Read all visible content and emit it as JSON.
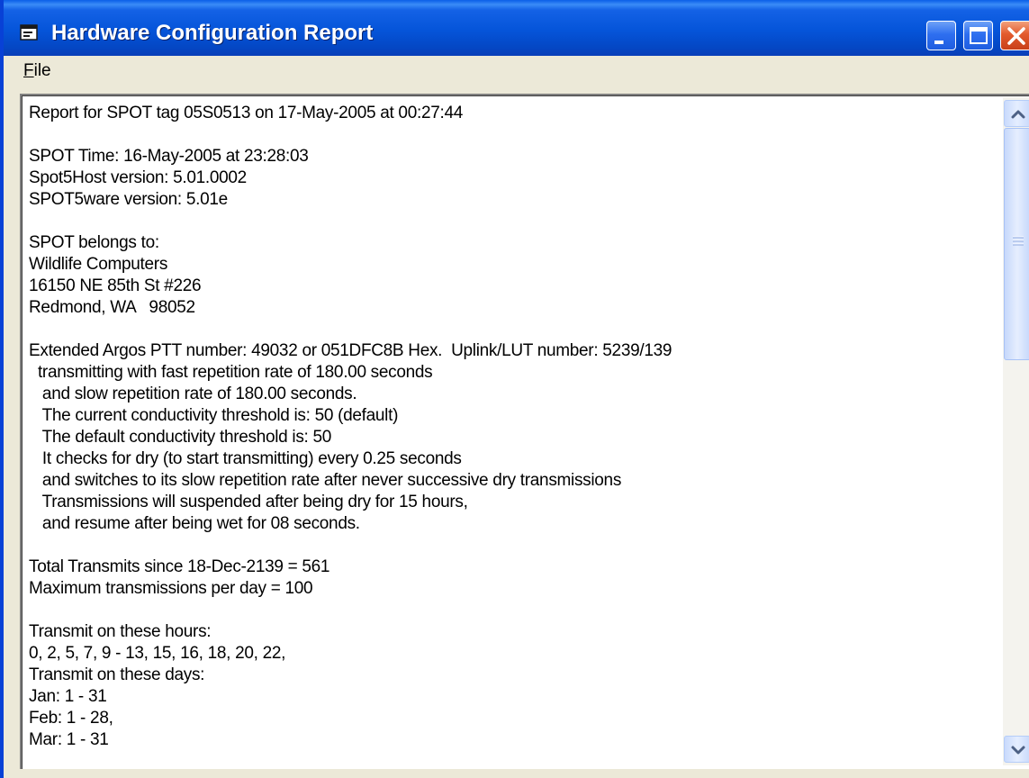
{
  "window": {
    "title": "Hardware Configuration Report",
    "icon": "app-window-icon",
    "controls": [
      "minimize-icon",
      "maximize-icon",
      "close-icon"
    ]
  },
  "menu": {
    "file_underlined": "F",
    "file_rest": "ile"
  },
  "report": {
    "lines": [
      "Report for SPOT tag 05S0513 on 17-May-2005 at 00:27:44",
      "",
      "SPOT Time: 16-May-2005 at 23:28:03",
      "Spot5Host version: 5.01.0002",
      "SPOT5ware version: 5.01e",
      "",
      "SPOT belongs to:",
      "Wildlife Computers",
      "16150 NE 85th St #226",
      "Redmond, WA   98052",
      "",
      "Extended Argos PTT number: 49032 or 051DFC8B Hex.  Uplink/LUT number: 5239/139",
      "  transmitting with fast repetition rate of 180.00 seconds",
      "   and slow repetition rate of 180.00 seconds.",
      "   The current conductivity threshold is: 50 (default)",
      "   The default conductivity threshold is: 50",
      "   It checks for dry (to start transmitting) every 0.25 seconds",
      "   and switches to its slow repetition rate after never successive dry transmissions",
      "   Transmissions will suspended after being dry for 15 hours,",
      "   and resume after being wet for 08 seconds.",
      "",
      "Total Transmits since 18-Dec-2139 = 561",
      "Maximum transmissions per day = 100",
      "",
      "Transmit on these hours:",
      "0, 2, 5, 7, 9 - 13, 15, 16, 18, 20, 22,",
      "Transmit on these days:",
      "Jan: 1 - 31",
      "Feb: 1 - 28,",
      "Mar: 1 - 31"
    ]
  },
  "scrollbar": {
    "up_icon": "chevron-up-icon",
    "down_icon": "chevron-down-icon",
    "grip_icon": "grip-icon"
  },
  "colors": {
    "titlebar": "#0554d9",
    "close_button": "#e35a2d",
    "window_face": "#ece9d8"
  }
}
